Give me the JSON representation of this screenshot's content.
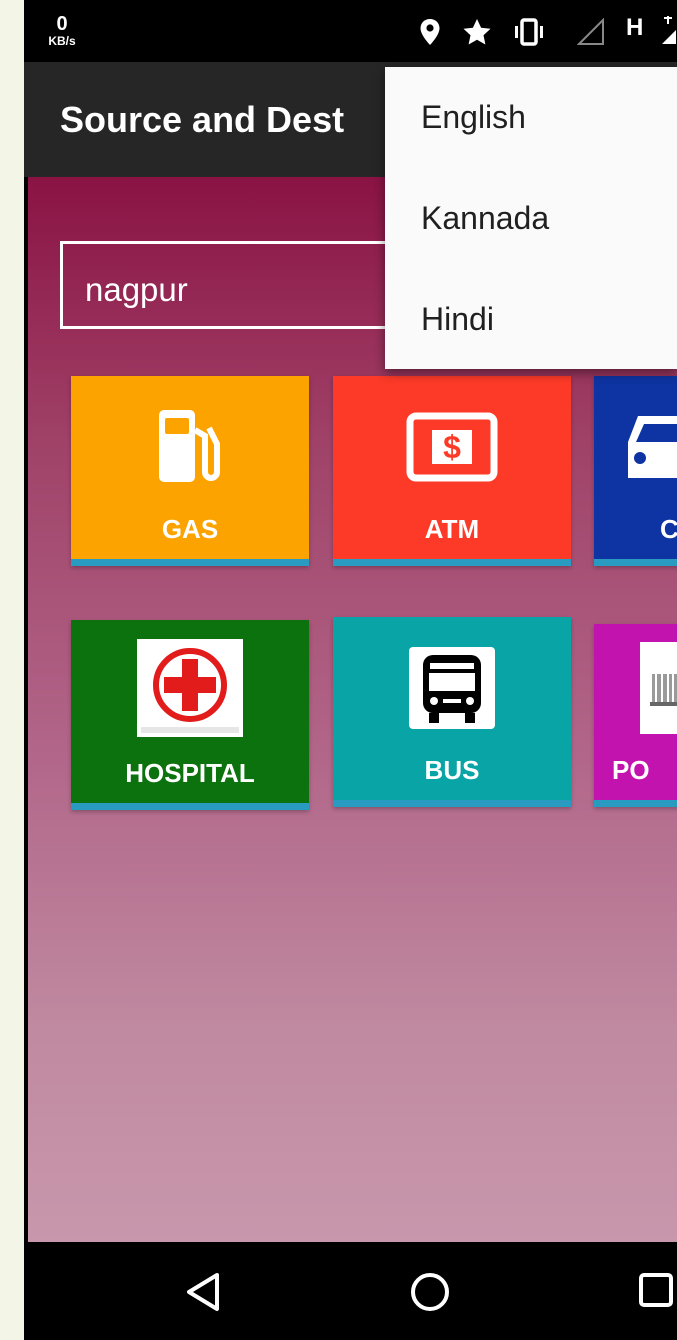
{
  "status_bar": {
    "speed_value": "0",
    "speed_unit": "KB/s",
    "icons": [
      "location-icon",
      "star-icon",
      "vibrate-icon",
      "signal-icon",
      "h-network-icon"
    ],
    "network_label": "H"
  },
  "app_bar": {
    "title": "Source and Dest"
  },
  "search": {
    "value": "nagpur"
  },
  "tiles": [
    {
      "label": "GAS",
      "icon": "fuel-pump-icon",
      "color": "#fca300"
    },
    {
      "label": "ATM",
      "icon": "dollar-card-icon",
      "color": "#fd3a28"
    },
    {
      "label": "C",
      "icon": "car-icon",
      "color": "#0d34a2"
    },
    {
      "label": "HOSPITAL",
      "icon": "hospital-cross-icon",
      "color": "#0b720e"
    },
    {
      "label": "BUS",
      "icon": "bus-icon",
      "color": "#08a4a6"
    },
    {
      "label": "PO",
      "icon": "police-building-icon",
      "color": "#c313ae"
    }
  ],
  "language_menu": {
    "items": [
      "English",
      "Kannada",
      "Hindi"
    ]
  },
  "nav_bar": {
    "icons": [
      "back-icon",
      "home-icon",
      "recents-icon"
    ]
  },
  "colors": {
    "accent_underline": "#2a9bc0",
    "app_bar": "#262626",
    "content_top": "#8a1344"
  }
}
